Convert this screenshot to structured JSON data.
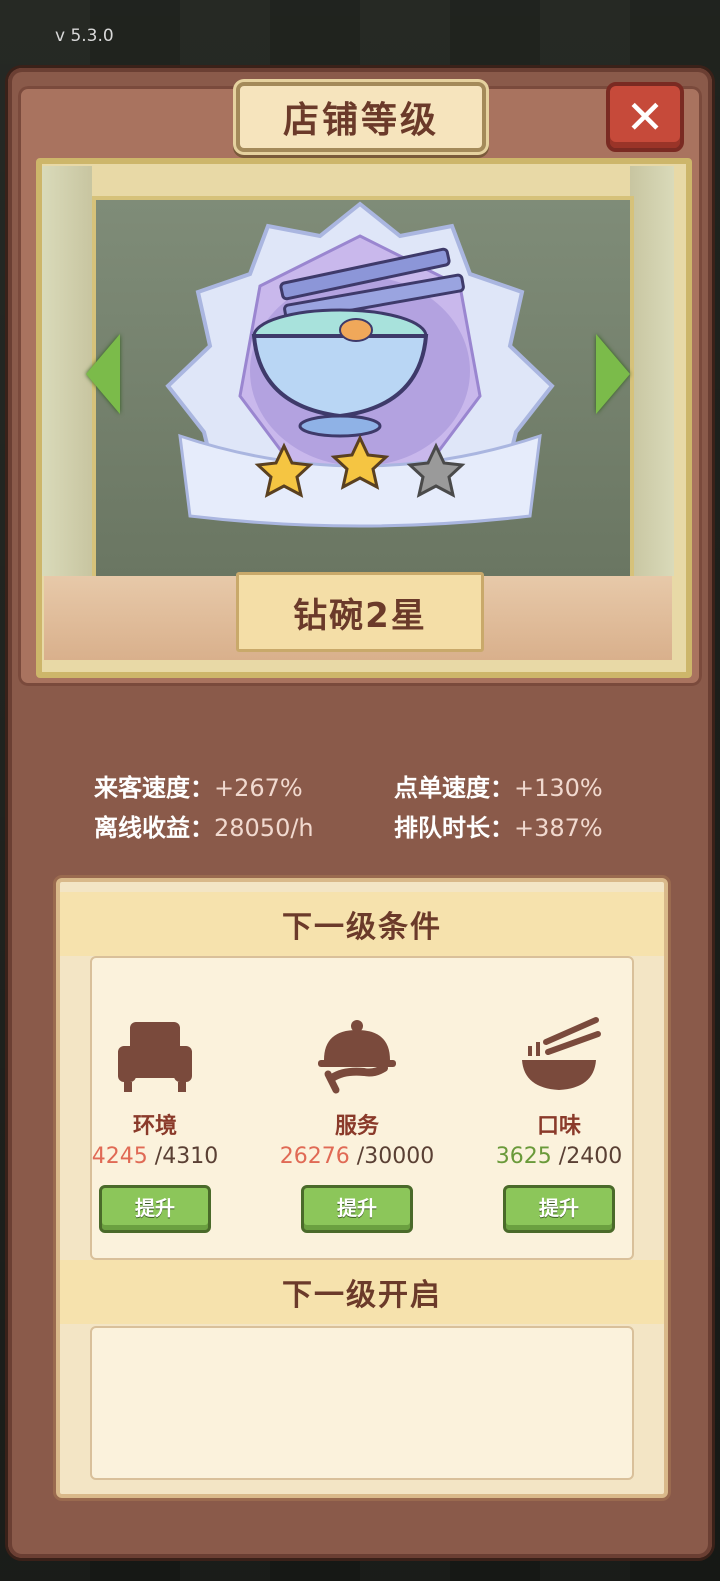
{
  "version": "v  5.3.0",
  "title": "店铺等级",
  "close_icon": "close-icon",
  "rank": {
    "name": "钻碗2星",
    "stars_filled": 2,
    "stars_total": 3
  },
  "stats": [
    {
      "label": "来客速度：",
      "value": "+267%"
    },
    {
      "label": "点单速度：",
      "value": "+130%"
    },
    {
      "label": "离线收益：",
      "value": "28050/h"
    },
    {
      "label": "排队时长：",
      "value": "+387%"
    }
  ],
  "next_conditions": {
    "header": "下一级条件",
    "items": [
      {
        "icon": "armchair-icon",
        "label": "环境",
        "current": "4245",
        "target": "/4310",
        "status": "insufficient",
        "button": "提升"
      },
      {
        "icon": "cloche-icon",
        "label": "服务",
        "current": "26276",
        "target": "/30000",
        "status": "insufficient",
        "button": "提升"
      },
      {
        "icon": "bowl-chopsticks-icon",
        "label": "口味",
        "current": "3625",
        "target": "/2400",
        "status": "met",
        "button": "提升"
      }
    ]
  },
  "next_unlock": {
    "header": "下一级开启"
  },
  "colors": {
    "accent_brown": "#6b3a2a",
    "insufficient": "#e06a55",
    "met": "#6a9a3a",
    "button_green": "#8cc65a"
  }
}
